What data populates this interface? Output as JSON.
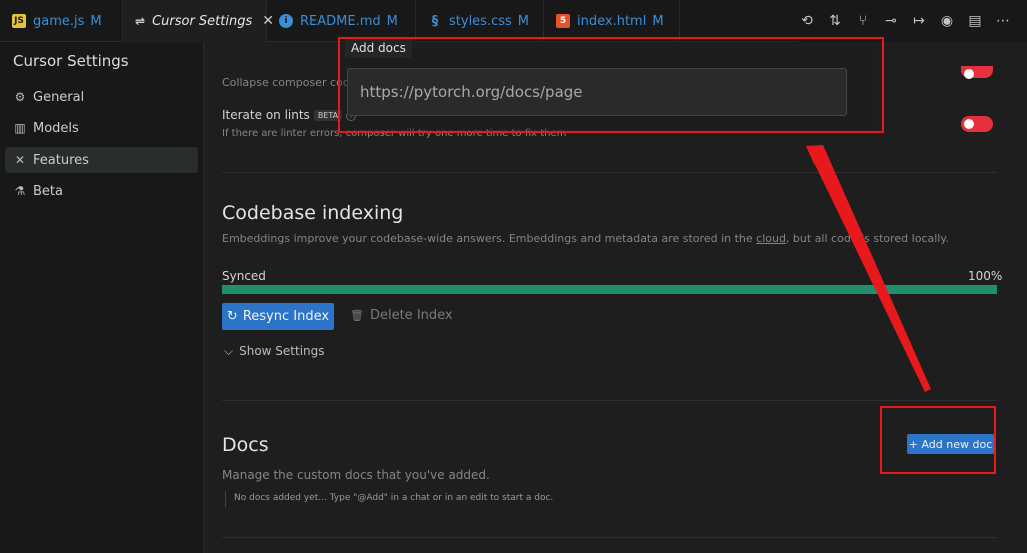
{
  "tabs": [
    {
      "label": "game.js",
      "modified": "M",
      "icon": "js-icon",
      "icon_text": "JS",
      "icon_color": "#e8c33a"
    },
    {
      "label": "Cursor Settings",
      "modified": "",
      "icon": "settings-icon",
      "icon_text": "⇌",
      "close": "✕"
    },
    {
      "label": "README.md",
      "modified": "M",
      "icon": "info-icon",
      "icon_text": "i",
      "icon_color": "#3a8fd6"
    },
    {
      "label": "styles.css",
      "modified": "M",
      "icon": "css-icon",
      "icon_text": "§",
      "icon_color": "#3a8fd6"
    },
    {
      "label": "index.html",
      "modified": "M",
      "icon": "html-icon",
      "icon_text": "5",
      "icon_color": "#e5532d"
    }
  ],
  "tab_actions": [
    "history-icon",
    "compare-icon",
    "source-control-icon",
    "commit-icon",
    "forward-icon",
    "account-icon",
    "split-editor-icon",
    "more-icon"
  ],
  "sidebar": {
    "title": "Cursor Settings",
    "items": [
      {
        "label": "General",
        "icon": "gear-icon"
      },
      {
        "label": "Models",
        "icon": "chart-icon"
      },
      {
        "label": "Features",
        "icon": "tools-icon",
        "active": true
      },
      {
        "label": "Beta",
        "icon": "flask-icon"
      }
    ]
  },
  "features": {
    "collapse_text": "Collapse composer code",
    "iterate_title": "Iterate on lints",
    "iterate_badge": "BETA",
    "iterate_desc": "If there are linter errors, composer will try one more time to fix them",
    "codebase": {
      "title": "Codebase indexing",
      "desc_before": "Embeddings improve your codebase-wide answers. Embeddings and metadata are stored in the ",
      "desc_link": "cloud",
      "desc_after": ", but all code is stored locally.",
      "status": "Synced",
      "percent": "100%",
      "progress": 1.0,
      "resync_label": "Resync Index",
      "delete_label": "Delete Index",
      "show_settings": "Show Settings"
    },
    "docs": {
      "title": "Docs",
      "desc": "Manage the custom docs that you've added.",
      "empty": "No docs added yet... Type \"@Add\" in a chat or in an edit to start a doc.",
      "add_label": "+ Add new doc"
    }
  },
  "popup": {
    "label": "Add docs",
    "placeholder": "https://pytorch.org/docs/page"
  },
  "colors": {
    "accent": "#2b74c8",
    "toggle_on": "#e5313d",
    "progress": "#1f8f6d",
    "annotation": "#e8191c"
  }
}
